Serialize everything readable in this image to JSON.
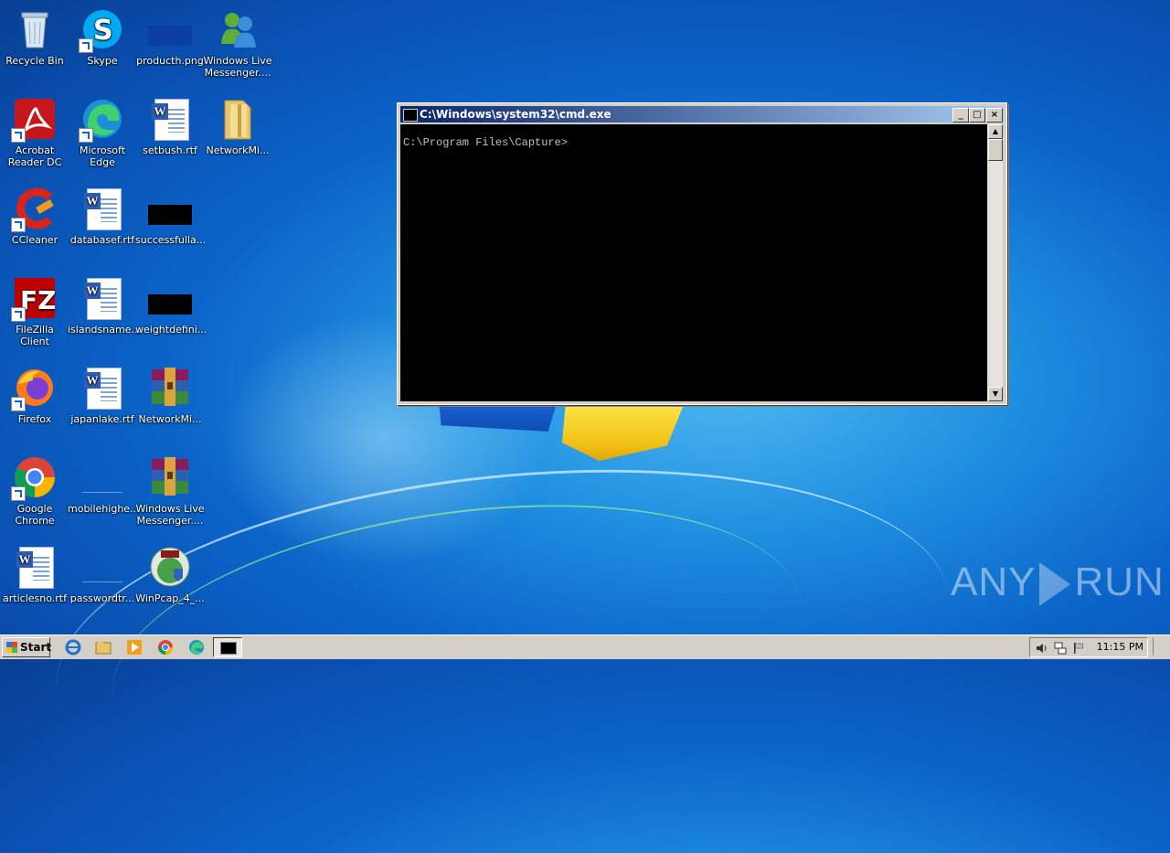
{
  "desktop": {
    "icons": [
      {
        "label": "Recycle Bin"
      },
      {
        "label": "Skype"
      },
      {
        "label": "producth.png"
      },
      {
        "label": "Windows Live Messenger...."
      },
      {
        "label": "Acrobat Reader DC"
      },
      {
        "label": "Microsoft Edge"
      },
      {
        "label": "setbush.rtf"
      },
      {
        "label": "NetworkMi..."
      },
      {
        "label": "CCleaner"
      },
      {
        "label": "databasef.rtf"
      },
      {
        "label": "successfulla..."
      },
      {
        "label": "FileZilla Client"
      },
      {
        "label": "islandsname..."
      },
      {
        "label": "weightdefini..."
      },
      {
        "label": "Firefox"
      },
      {
        "label": "japanlake.rtf"
      },
      {
        "label": "NetworkMi..."
      },
      {
        "label": "Google Chrome"
      },
      {
        "label": "mobilehighe..."
      },
      {
        "label": "Windows Live Messenger...."
      },
      {
        "label": "articlesno.rtf"
      },
      {
        "label": "passwordtr..."
      },
      {
        "label": "WinPcap_4_..."
      }
    ]
  },
  "cmd_window": {
    "title": "C:\\Windows\\system32\\cmd.exe",
    "prompt": "C:\\Program Files\\Capture>",
    "minimize": "_",
    "maximize": "□",
    "close": "×"
  },
  "watermark": {
    "left": "ANY",
    "right": "RUN"
  },
  "taskbar": {
    "start_label": "Start",
    "clock": "11:15 PM"
  },
  "colors": {
    "titlebar_start": "#0a246a",
    "titlebar_end": "#a6caf0",
    "console_bg": "#000000",
    "console_text": "#c0c0c0"
  }
}
